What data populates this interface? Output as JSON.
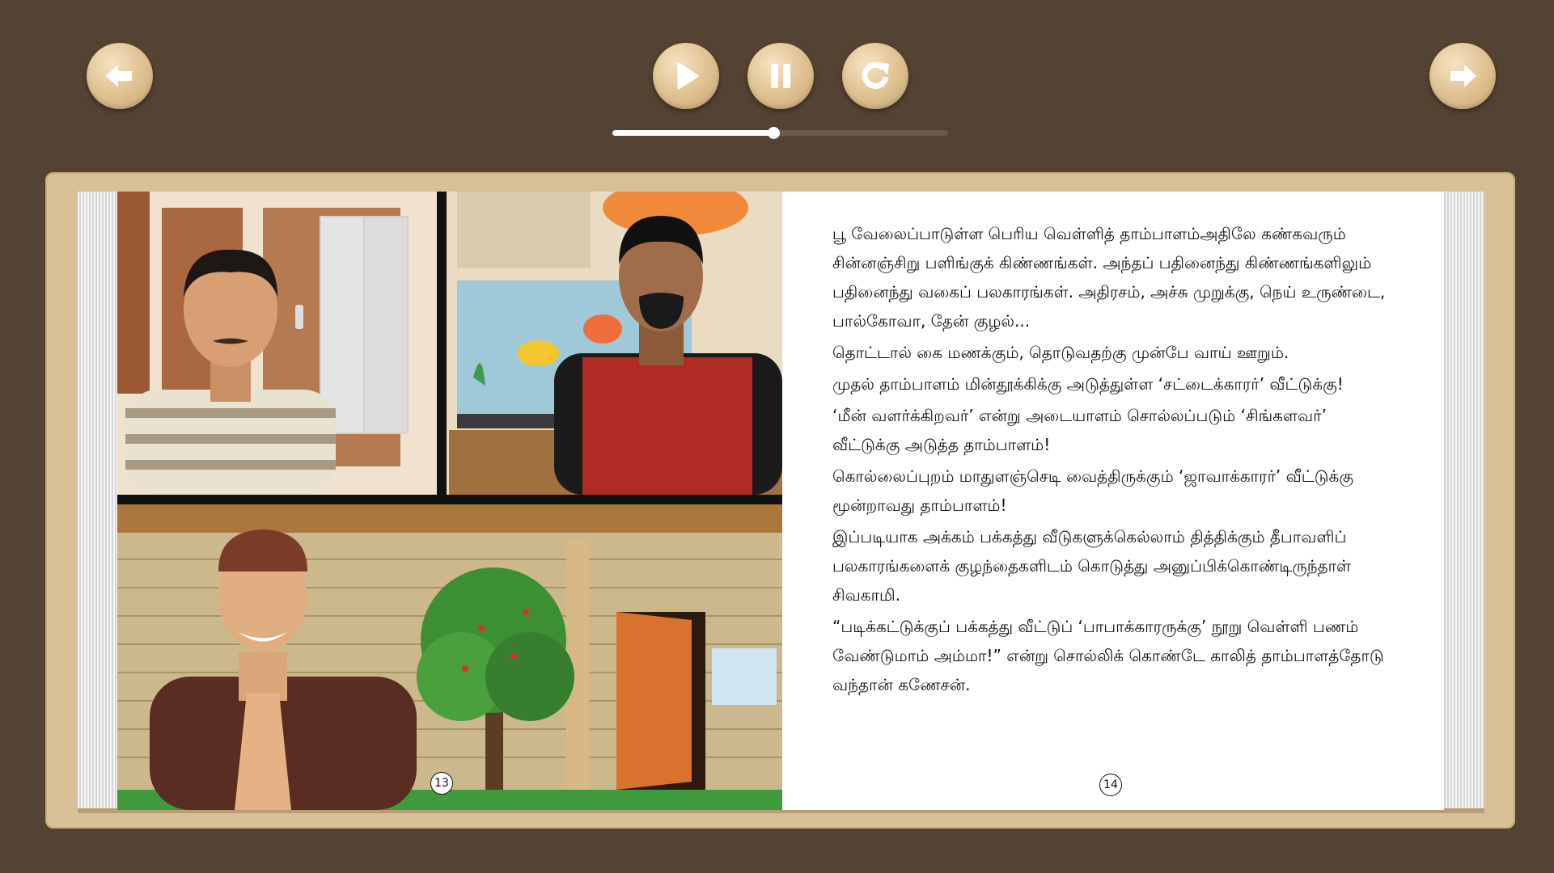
{
  "controls": {
    "back": "back-arrow-icon",
    "play": "play-icon",
    "pause": "pause-icon",
    "replay": "replay-icon",
    "next": "next-arrow-icon"
  },
  "progress": {
    "fraction": 0.48
  },
  "colors": {
    "background": "#544232",
    "frame": "#d9bf95",
    "button": "#e2c597",
    "icon": "#ffffff"
  },
  "pages": {
    "left": {
      "number": "13"
    },
    "right": {
      "number": "14",
      "paragraphs": [
        "பூ வேலைப்பாடுள்ள பெரிய வெள்ளித் தாம்பாளம்அதிலே கண்கவரும் சின்னஞ்சிறு பளிங்குக் கிண்ணங்கள். அந்தப் பதினைந்து கிண்ணங்களிலும் பதினைந்து வகைப் பலகாரங்கள். அதிரசம், அச்சு முறுக்கு, நெய் உருண்டை, பால்கோவா, தேன் குழல்...",
        "தொட்டால் கை மணக்கும், தொடுவதற்கு முன்பே வாய் ஊறும்.",
        "முதல் தாம்பாளம் மின்தூக்கிக்கு அடுத்துள்ள ‘சட்டைக்காரர்’ வீட்டுக்கு!",
        "‘மீன் வளர்க்கிறவர்’ என்று அடையாளம் சொல்லப்படும் ‘சிங்களவர்’ வீட்டுக்கு அடுத்த தாம்பாளம்!",
        "கொல்லைப்புறம் மாதுளஞ்செடி வைத்திருக்கும் ‘ஜாவாக்காரர்’ வீட்டுக்கு மூன்றாவது தாம்பாளம்!",
        "இப்படியாக அக்கம் பக்கத்து வீடுகளுக்கெல்லாம் தித்திக்கும் தீபாவளிப் பலகாரங்களைக் குழந்தைகளிடம் கொடுத்து அனுப்பிக்கொண்டிருந்தாள் சிவகாமி.",
        "“படிக்கட்டுக்குப் பக்கத்து வீட்டுப் ‘பாபாக்காரருக்கு’ நூறு வெள்ளி பணம் வேண்டுமாம் அம்மா!” என்று சொல்லிக் கொண்டே காலித் தாம்பாளத்தோடு வந்தான் கணேசன்."
      ]
    }
  }
}
